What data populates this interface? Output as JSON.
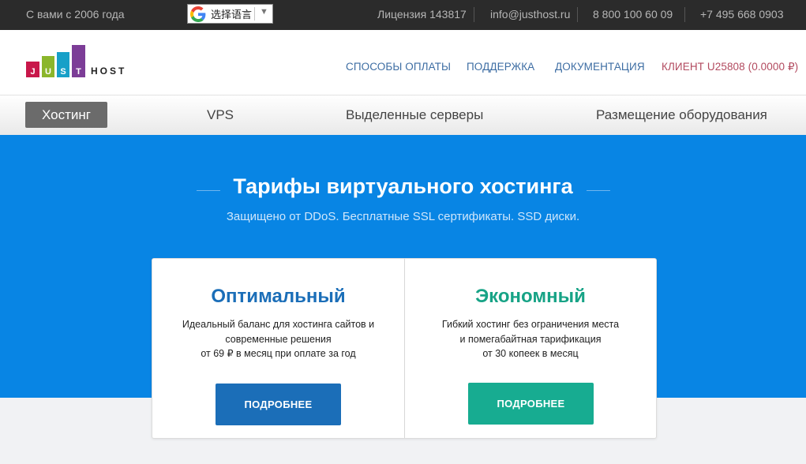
{
  "topbar": {
    "since": "С вами с 2006 года",
    "translate_label": "选择语言",
    "license": "Лицензия 143817",
    "email": "info@justhost.ru",
    "phone1": "8 800 100 60 09",
    "phone2": "+7 495 668 0903"
  },
  "logo": {
    "letters_left": [
      "J",
      "U",
      "S",
      "T"
    ],
    "text_right": "HOST",
    "colors": [
      "#c8174a",
      "#8bb62b",
      "#17a0c8",
      "#7c3d97"
    ]
  },
  "topnav": {
    "payment": "СПОСОБЫ ОПЛАТЫ",
    "support": "ПОДДЕРЖКА",
    "docs": "ДОКУМЕНТАЦИЯ",
    "client": "КЛИЕНТ U25808 (0.0000 ₽)"
  },
  "catnav": {
    "hosting": "Хостинг",
    "vps": "VPS",
    "dedicated": "Выделенные серверы",
    "colocation": "Размещение оборудования"
  },
  "hero": {
    "title": "Тарифы виртуального хостинга",
    "subtitle": "Защищено от DDoS. Бесплатные SSL сертификаты. SSD диски."
  },
  "plans": [
    {
      "name": "Оптимальный",
      "desc_lines": [
        "Идеальный баланс для хостинга сайтов и",
        "современные решения",
        "от 69 ₽ в месяц при оплате за год"
      ],
      "button": "ПОДРОБНЕЕ",
      "color": "#1b6eb8"
    },
    {
      "name": "Экономный",
      "desc_lines": [
        "Гибкий хостинг без ограничения места",
        "и помегабайтная тарификация",
        "от 30 копеек в месяц"
      ],
      "button": "ПОДРОБНЕЕ",
      "color": "#17ac91"
    }
  ],
  "colors": {
    "topbar_bg": "#2b2b2b",
    "hero_bg": "#0885e4",
    "link": "#3d6da3",
    "client_link": "#b24a5f"
  }
}
